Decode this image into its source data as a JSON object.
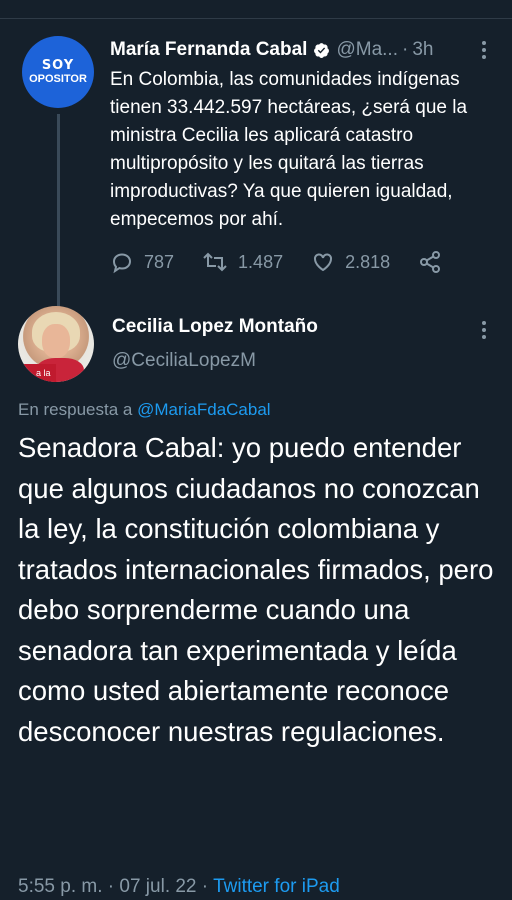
{
  "parent_tweet": {
    "avatar_line1": "SOY",
    "avatar_line2": "OPOSITOR",
    "name": "María Fernanda Cabal",
    "handle": "@Ma...",
    "dot": "·",
    "time": "3h",
    "text": "En Colombia, las comunidades indígenas tienen 33.442.597 hectáreas, ¿será que la ministra Cecilia les aplicará catastro multipropósito y les quitará las tierras improductivas? Ya que quieren igualdad, empecemos por ahí.",
    "replies": "787",
    "retweets": "1.487",
    "likes": "2.818",
    "icons": [
      "reply-icon",
      "retweet-icon",
      "like-icon",
      "share-icon",
      "more-icon",
      "verified-icon"
    ]
  },
  "main_tweet": {
    "name": "Cecilia Lopez Montaño",
    "handle": "@CeciliaLopezM",
    "reply_prefix": "En respuesta a",
    "reply_handle": "@MariaFdaCabal",
    "avatar_badge": "a la P",
    "text": "Senadora Cabal: yo puedo entender que algunos ciudadanos no conozcan la ley, la constitución colombiana y tratados internacionales firmados, pero debo sorprenderme cuando una senadora tan experimentada y leída como usted abiertamente reconoce desconocer nuestras regulaciones.",
    "time": "5:55 p. m.",
    "sep1": "·",
    "date": "07 jul. 22",
    "sep2": "·",
    "source": "Twitter for iPad"
  },
  "colors": {
    "background": "#15202b",
    "secondary_text": "#8899a6",
    "link": "#1d9bf0",
    "opositor_blue": "#1d63d9"
  }
}
